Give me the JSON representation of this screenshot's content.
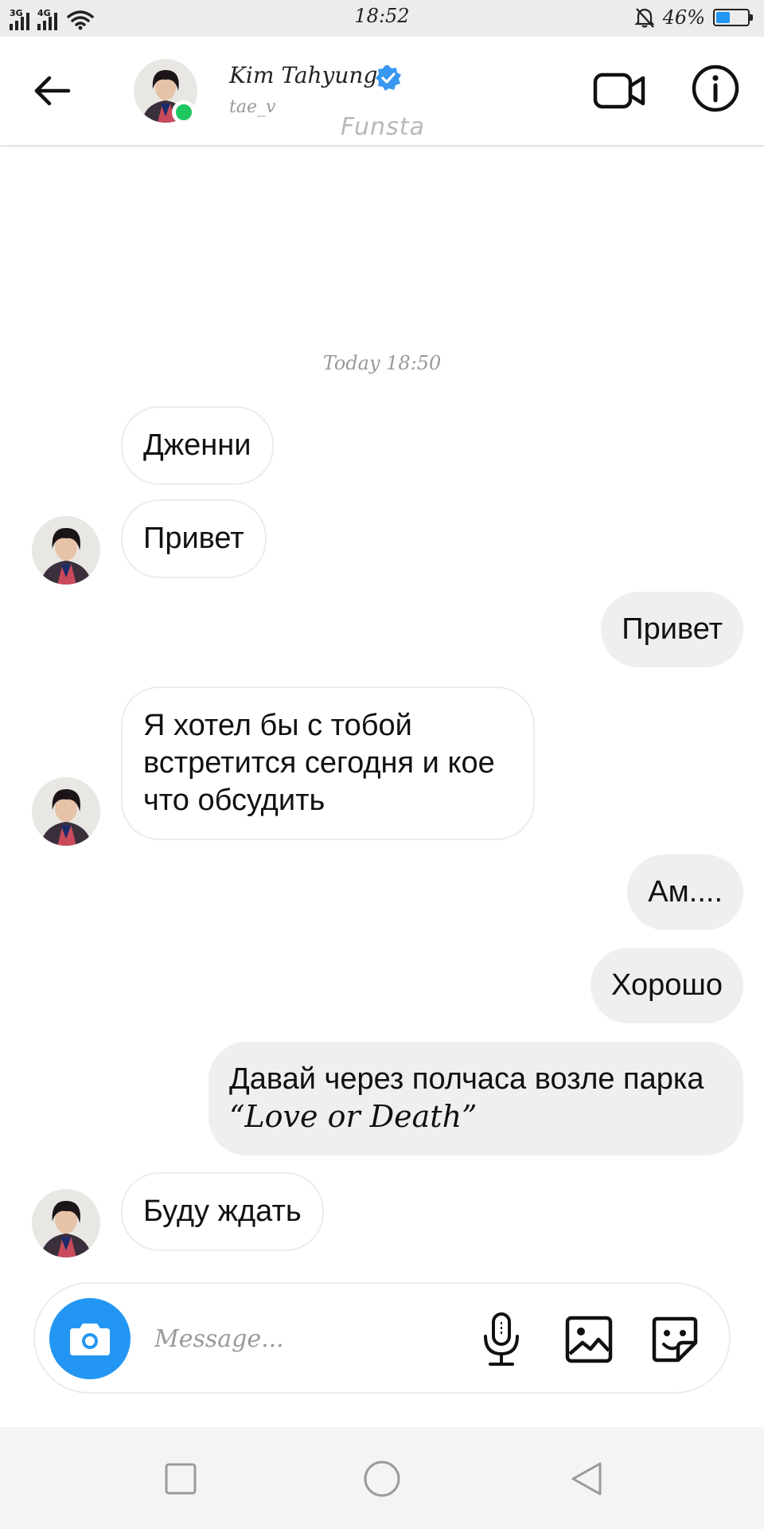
{
  "status_bar": {
    "net1": "3G",
    "net2": "4G",
    "time": "18:52",
    "battery_text": "46%",
    "battery_level": 0.46,
    "icons": [
      "signal-icon",
      "wifi-icon",
      "mute-bell-icon",
      "battery-icon"
    ]
  },
  "header": {
    "name": "Kim Tahyung",
    "handle": "tae_v",
    "tag": "Funsta",
    "online": true,
    "verified": true,
    "icons": [
      "back-arrow-icon",
      "verified-badge-icon",
      "video-camera-icon",
      "info-icon"
    ]
  },
  "chat": {
    "timestamp": "Today 18:50",
    "messages": [
      {
        "dir": "in",
        "text": "Дженни"
      },
      {
        "dir": "in",
        "text": "Привет"
      },
      {
        "dir": "out",
        "text": "Привет"
      },
      {
        "dir": "in",
        "text": "Я хотел бы с тобой встретится сегодня и кое что обсудить"
      },
      {
        "dir": "out",
        "text": "Ам...."
      },
      {
        "dir": "out",
        "text": "Хорошо"
      },
      {
        "dir": "out",
        "text_a": "Давай через полчаса возле парка ",
        "text_b": "“Love or Death”"
      },
      {
        "dir": "in",
        "text": "Буду ждать"
      }
    ]
  },
  "composer": {
    "placeholder": "Message...",
    "icons": [
      "camera-icon",
      "microphone-icon",
      "gallery-icon",
      "sticker-icon"
    ]
  },
  "colors": {
    "accent_blue": "#2396f3",
    "online_green": "#1ec760",
    "outgoing_bubble": "#efeef0",
    "incoming_border": "#ececec"
  },
  "nav_bar": {
    "icons": [
      "recents-square-icon",
      "home-circle-icon",
      "back-triangle-icon"
    ]
  }
}
